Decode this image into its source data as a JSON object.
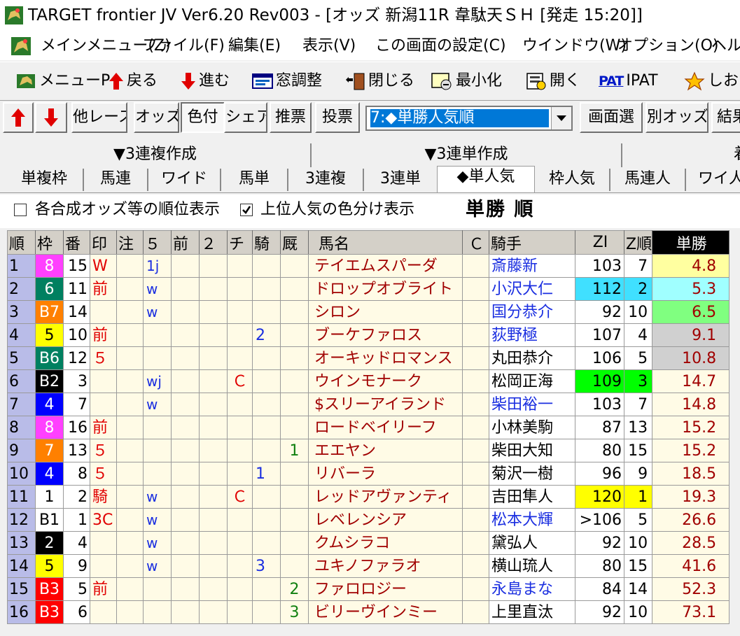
{
  "window": {
    "title": "TARGET frontier JV  Ver6.20  Rev003 - [オッズ 新潟11R 韋駄天ＳＨ  [発走 15:20]]"
  },
  "menu": [
    "メインメニュー(Z)",
    "ファイル(F)",
    "編集(E)",
    "表示(V)",
    "この画面の設定(C)",
    "ウインドウ(W)",
    "オプション(O)",
    "ヘルプ"
  ],
  "toolbar": [
    {
      "label": "メニューP",
      "icon": "horse-menu-icon"
    },
    {
      "label": "戻る",
      "icon": "arrow-up-icon"
    },
    {
      "label": "進む",
      "icon": "arrow-down-icon"
    },
    {
      "label": "窓調整",
      "icon": "window-adjust-icon"
    },
    {
      "label": "閉じる",
      "icon": "door-close-icon"
    },
    {
      "label": "最小化",
      "icon": "minimize-icon"
    },
    {
      "label": "開く",
      "icon": "open-icon"
    },
    {
      "label": "IPAT",
      "icon": "pat-icon",
      "icon_text": "PAT"
    },
    {
      "label": "しおり",
      "icon": "bookmark-icon"
    }
  ],
  "buttons": {
    "up": "▲",
    "down": "▼",
    "other_race": "他レース",
    "odds": "オッズ",
    "color": "色付",
    "share": "シェア",
    "recommend": "推票",
    "vote": "投票",
    "screen_select": "画面選",
    "other_odds": "別オッズ",
    "result": "結果"
  },
  "display_select": {
    "value": "7:◆単勝人気順"
  },
  "tabs_top": [
    "▼3連複作成",
    "▼3連単作成",
    "着"
  ],
  "tabs": [
    "単複枠",
    "馬連",
    "ワイド",
    "馬単",
    "3連複",
    "3連単",
    "◆単人気",
    "枠人気",
    "馬連人",
    "ワイ人"
  ],
  "active_tab": "◆単人気",
  "options": {
    "rank_display": {
      "label": "各合成オッズ等の順位表示",
      "checked": false
    },
    "color_split": {
      "label": "上位人気の色分け表示",
      "checked": true
    },
    "sort_label": "単勝 順"
  },
  "columns": [
    "順",
    "枠",
    "番",
    "印",
    "注",
    "５",
    "前",
    "２",
    "チ",
    "騎",
    "厩",
    "馬名",
    "Ｃ",
    "騎手",
    "ZI",
    "Z順",
    "単勝"
  ],
  "colors": {
    "frame_black": "#000000",
    "frame_blue": "#0000ff",
    "frame_yellow": "#ffff00",
    "frame_green": "#006600",
    "frame_orange": "#ff8000",
    "frame_pink": "#ff40ff",
    "frame_white": "#ffffff",
    "frame_red": "#ff0000",
    "highlight_cyan": "#40e0ff",
    "highlight_green": "#00ff00",
    "highlight_yellow": "#ffff00",
    "odds_yellow": "#ffffa0",
    "odds_cyan": "#a0ffff",
    "odds_green": "#80ff80",
    "odds_gray": "#d0d0d0"
  },
  "rows": [
    {
      "rank": "1",
      "frame": "8",
      "frame_bg": "#ff40ff",
      "frame_fg": "#ffffff",
      "num": "15",
      "mark": "W",
      "chu": "",
      "five": "1j",
      "mae": "",
      "two": "",
      "chi": "",
      "ki": "",
      "kyu": "",
      "horse": "テイエムスパーダ",
      "c": "",
      "jockey": "斎藤新",
      "jockey_blue": true,
      "zi": "103",
      "zi_bg": "",
      "zr": "7",
      "odds": "4.8",
      "odds_bg": "#ffffa0"
    },
    {
      "rank": "2",
      "frame": "6",
      "frame_bg": "#008060",
      "frame_fg": "#ffffff",
      "num": "11",
      "mark": "前",
      "chu": "",
      "five": "w",
      "mae": "",
      "two": "",
      "chi": "",
      "ki": "",
      "kyu": "",
      "horse": "ドロップオブライト",
      "c": "",
      "jockey": "小沢大仁",
      "jockey_blue": true,
      "zi": "112",
      "zi_bg": "#40e0ff",
      "zr": "2",
      "odds": "5.3",
      "odds_bg": "#a0ffff"
    },
    {
      "rank": "3",
      "frame": "B7",
      "frame_bg": "#ff8000",
      "frame_fg": "#ffffff",
      "num": "14",
      "mark": "",
      "chu": "",
      "five": "w",
      "mae": "",
      "two": "",
      "chi": "",
      "ki": "",
      "kyu": "",
      "horse": "シロン",
      "c": "",
      "jockey": "国分恭介",
      "jockey_blue": true,
      "zi": "92",
      "zi_bg": "",
      "zr": "10",
      "odds": "6.5",
      "odds_bg": "#80ff80"
    },
    {
      "rank": "4",
      "frame": "5",
      "frame_bg": "#ffff00",
      "frame_fg": "#000000",
      "num": "10",
      "mark": "前",
      "chu": "",
      "five": "",
      "mae": "",
      "two": "",
      "chi": "",
      "ki": "2",
      "kyu": "",
      "horse": "ブーケファロス",
      "c": "",
      "jockey": "荻野極",
      "jockey_blue": true,
      "zi": "107",
      "zi_bg": "",
      "zr": "4",
      "odds": "9.1",
      "odds_bg": "#d0d0d0"
    },
    {
      "rank": "5",
      "frame": "B6",
      "frame_bg": "#008060",
      "frame_fg": "#ffffff",
      "num": "12",
      "mark": "５",
      "chu": "",
      "five": "",
      "mae": "",
      "two": "",
      "chi": "",
      "ki": "",
      "kyu": "",
      "horse": "オーキッドロマンス",
      "c": "",
      "jockey": "丸田恭介",
      "jockey_blue": false,
      "zi": "106",
      "zi_bg": "",
      "zr": "5",
      "odds": "10.8",
      "odds_bg": "#d0d0d0"
    },
    {
      "rank": "6",
      "frame": "B2",
      "frame_bg": "#000000",
      "frame_fg": "#ffffff",
      "num": "3",
      "mark": "",
      "chu": "",
      "five": "wj",
      "mae": "",
      "two": "",
      "chi": "Ｃ",
      "ki": "",
      "kyu": "",
      "horse": "ウインモナーク",
      "c": "",
      "jockey": "松岡正海",
      "jockey_blue": false,
      "zi": "109",
      "zi_bg": "#00ff00",
      "zr": "3",
      "odds": "14.7",
      "odds_bg": ""
    },
    {
      "rank": "7",
      "frame": "4",
      "frame_bg": "#0000ff",
      "frame_fg": "#ffffff",
      "num": "7",
      "mark": "",
      "chu": "",
      "five": "w",
      "mae": "",
      "two": "",
      "chi": "",
      "ki": "",
      "kyu": "",
      "horse": "$スリーアイランド",
      "c": "",
      "jockey": "柴田裕一",
      "jockey_blue": true,
      "zi": "103",
      "zi_bg": "",
      "zr": "7",
      "odds": "14.8",
      "odds_bg": ""
    },
    {
      "rank": "8",
      "frame": "8",
      "frame_bg": "#ff40ff",
      "frame_fg": "#ffffff",
      "num": "16",
      "mark": "前",
      "chu": "",
      "five": "",
      "mae": "",
      "two": "",
      "chi": "",
      "ki": "",
      "kyu": "",
      "horse": "ロードベイリーフ",
      "c": "",
      "jockey": "小林美駒",
      "jockey_blue": false,
      "zi": "87",
      "zi_bg": "",
      "zr": "13",
      "odds": "15.2",
      "odds_bg": ""
    },
    {
      "rank": "9",
      "frame": "7",
      "frame_bg": "#ff8000",
      "frame_fg": "#ffffff",
      "num": "13",
      "mark": "５",
      "chu": "",
      "five": "",
      "mae": "",
      "two": "",
      "chi": "",
      "ki": "",
      "kyu": "1",
      "horse": "エエヤン",
      "c": "",
      "jockey": "柴田大知",
      "jockey_blue": false,
      "zi": "80",
      "zi_bg": "",
      "zr": "15",
      "odds": "15.2",
      "odds_bg": ""
    },
    {
      "rank": "10",
      "frame": "4",
      "frame_bg": "#0000ff",
      "frame_fg": "#ffffff",
      "num": "8",
      "mark": "５",
      "chu": "",
      "five": "",
      "mae": "",
      "two": "",
      "chi": "",
      "ki": "1",
      "kyu": "",
      "horse": "リバーラ",
      "c": "",
      "jockey": "菊沢一樹",
      "jockey_blue": false,
      "zi": "96",
      "zi_bg": "",
      "zr": "9",
      "odds": "18.5",
      "odds_bg": ""
    },
    {
      "rank": "11",
      "frame": "1",
      "frame_bg": "#ffffff",
      "frame_fg": "#000000",
      "num": "2",
      "mark": "騎",
      "chu": "",
      "five": "w",
      "mae": "",
      "two": "",
      "chi": "Ｃ",
      "ki": "",
      "kyu": "",
      "horse": "レッドアヴァンティ",
      "c": "",
      "jockey": "吉田隼人",
      "jockey_blue": false,
      "zi": "120",
      "zi_bg": "#ffff00",
      "zr": "1",
      "odds": "19.3",
      "odds_bg": ""
    },
    {
      "rank": "12",
      "frame": "B1",
      "frame_bg": "#ffffff",
      "frame_fg": "#000000",
      "num": "1",
      "mark": "3C",
      "chu": "",
      "five": "w",
      "mae": "",
      "two": "",
      "chi": "",
      "ki": "",
      "kyu": "",
      "horse": "レベレンシア",
      "c": "",
      "jockey": "松本大輝",
      "jockey_blue": true,
      "zi": ">106",
      "zi_bg": "",
      "zr": "5",
      "odds": "26.6",
      "odds_bg": ""
    },
    {
      "rank": "13",
      "frame": "2",
      "frame_bg": "#000000",
      "frame_fg": "#ffffff",
      "num": "4",
      "mark": "",
      "chu": "",
      "five": "w",
      "mae": "",
      "two": "",
      "chi": "",
      "ki": "",
      "kyu": "",
      "horse": "クムシラコ",
      "c": "",
      "jockey": "黛弘人",
      "jockey_blue": false,
      "zi": "92",
      "zi_bg": "",
      "zr": "10",
      "odds": "28.5",
      "odds_bg": ""
    },
    {
      "rank": "14",
      "frame": "5",
      "frame_bg": "#ffff00",
      "frame_fg": "#000000",
      "num": "9",
      "mark": "",
      "chu": "",
      "five": "w",
      "mae": "",
      "two": "",
      "chi": "",
      "ki": "3",
      "kyu": "",
      "horse": "ユキノファラオ",
      "c": "",
      "jockey": "横山琉人",
      "jockey_blue": false,
      "zi": "80",
      "zi_bg": "",
      "zr": "15",
      "odds": "41.6",
      "odds_bg": ""
    },
    {
      "rank": "15",
      "frame": "B3",
      "frame_bg": "#ff0000",
      "frame_fg": "#ffffff",
      "num": "5",
      "mark": "前",
      "chu": "",
      "five": "",
      "mae": "",
      "two": "",
      "chi": "",
      "ki": "",
      "kyu": "2",
      "horse": "ファロロジー",
      "c": "",
      "jockey": "永島まな",
      "jockey_blue": true,
      "zi": "84",
      "zi_bg": "",
      "zr": "14",
      "odds": "52.3",
      "odds_bg": ""
    },
    {
      "rank": "16",
      "frame": "B3",
      "frame_bg": "#ff0000",
      "frame_fg": "#ffffff",
      "num": "6",
      "mark": "",
      "chu": "",
      "five": "",
      "mae": "",
      "two": "",
      "chi": "",
      "ki": "",
      "kyu": "3",
      "horse": "ビリーヴインミー",
      "c": "",
      "jockey": "上里直汰",
      "jockey_blue": false,
      "zi": "92",
      "zi_bg": "",
      "zr": "10",
      "odds": "73.1",
      "odds_bg": ""
    }
  ]
}
